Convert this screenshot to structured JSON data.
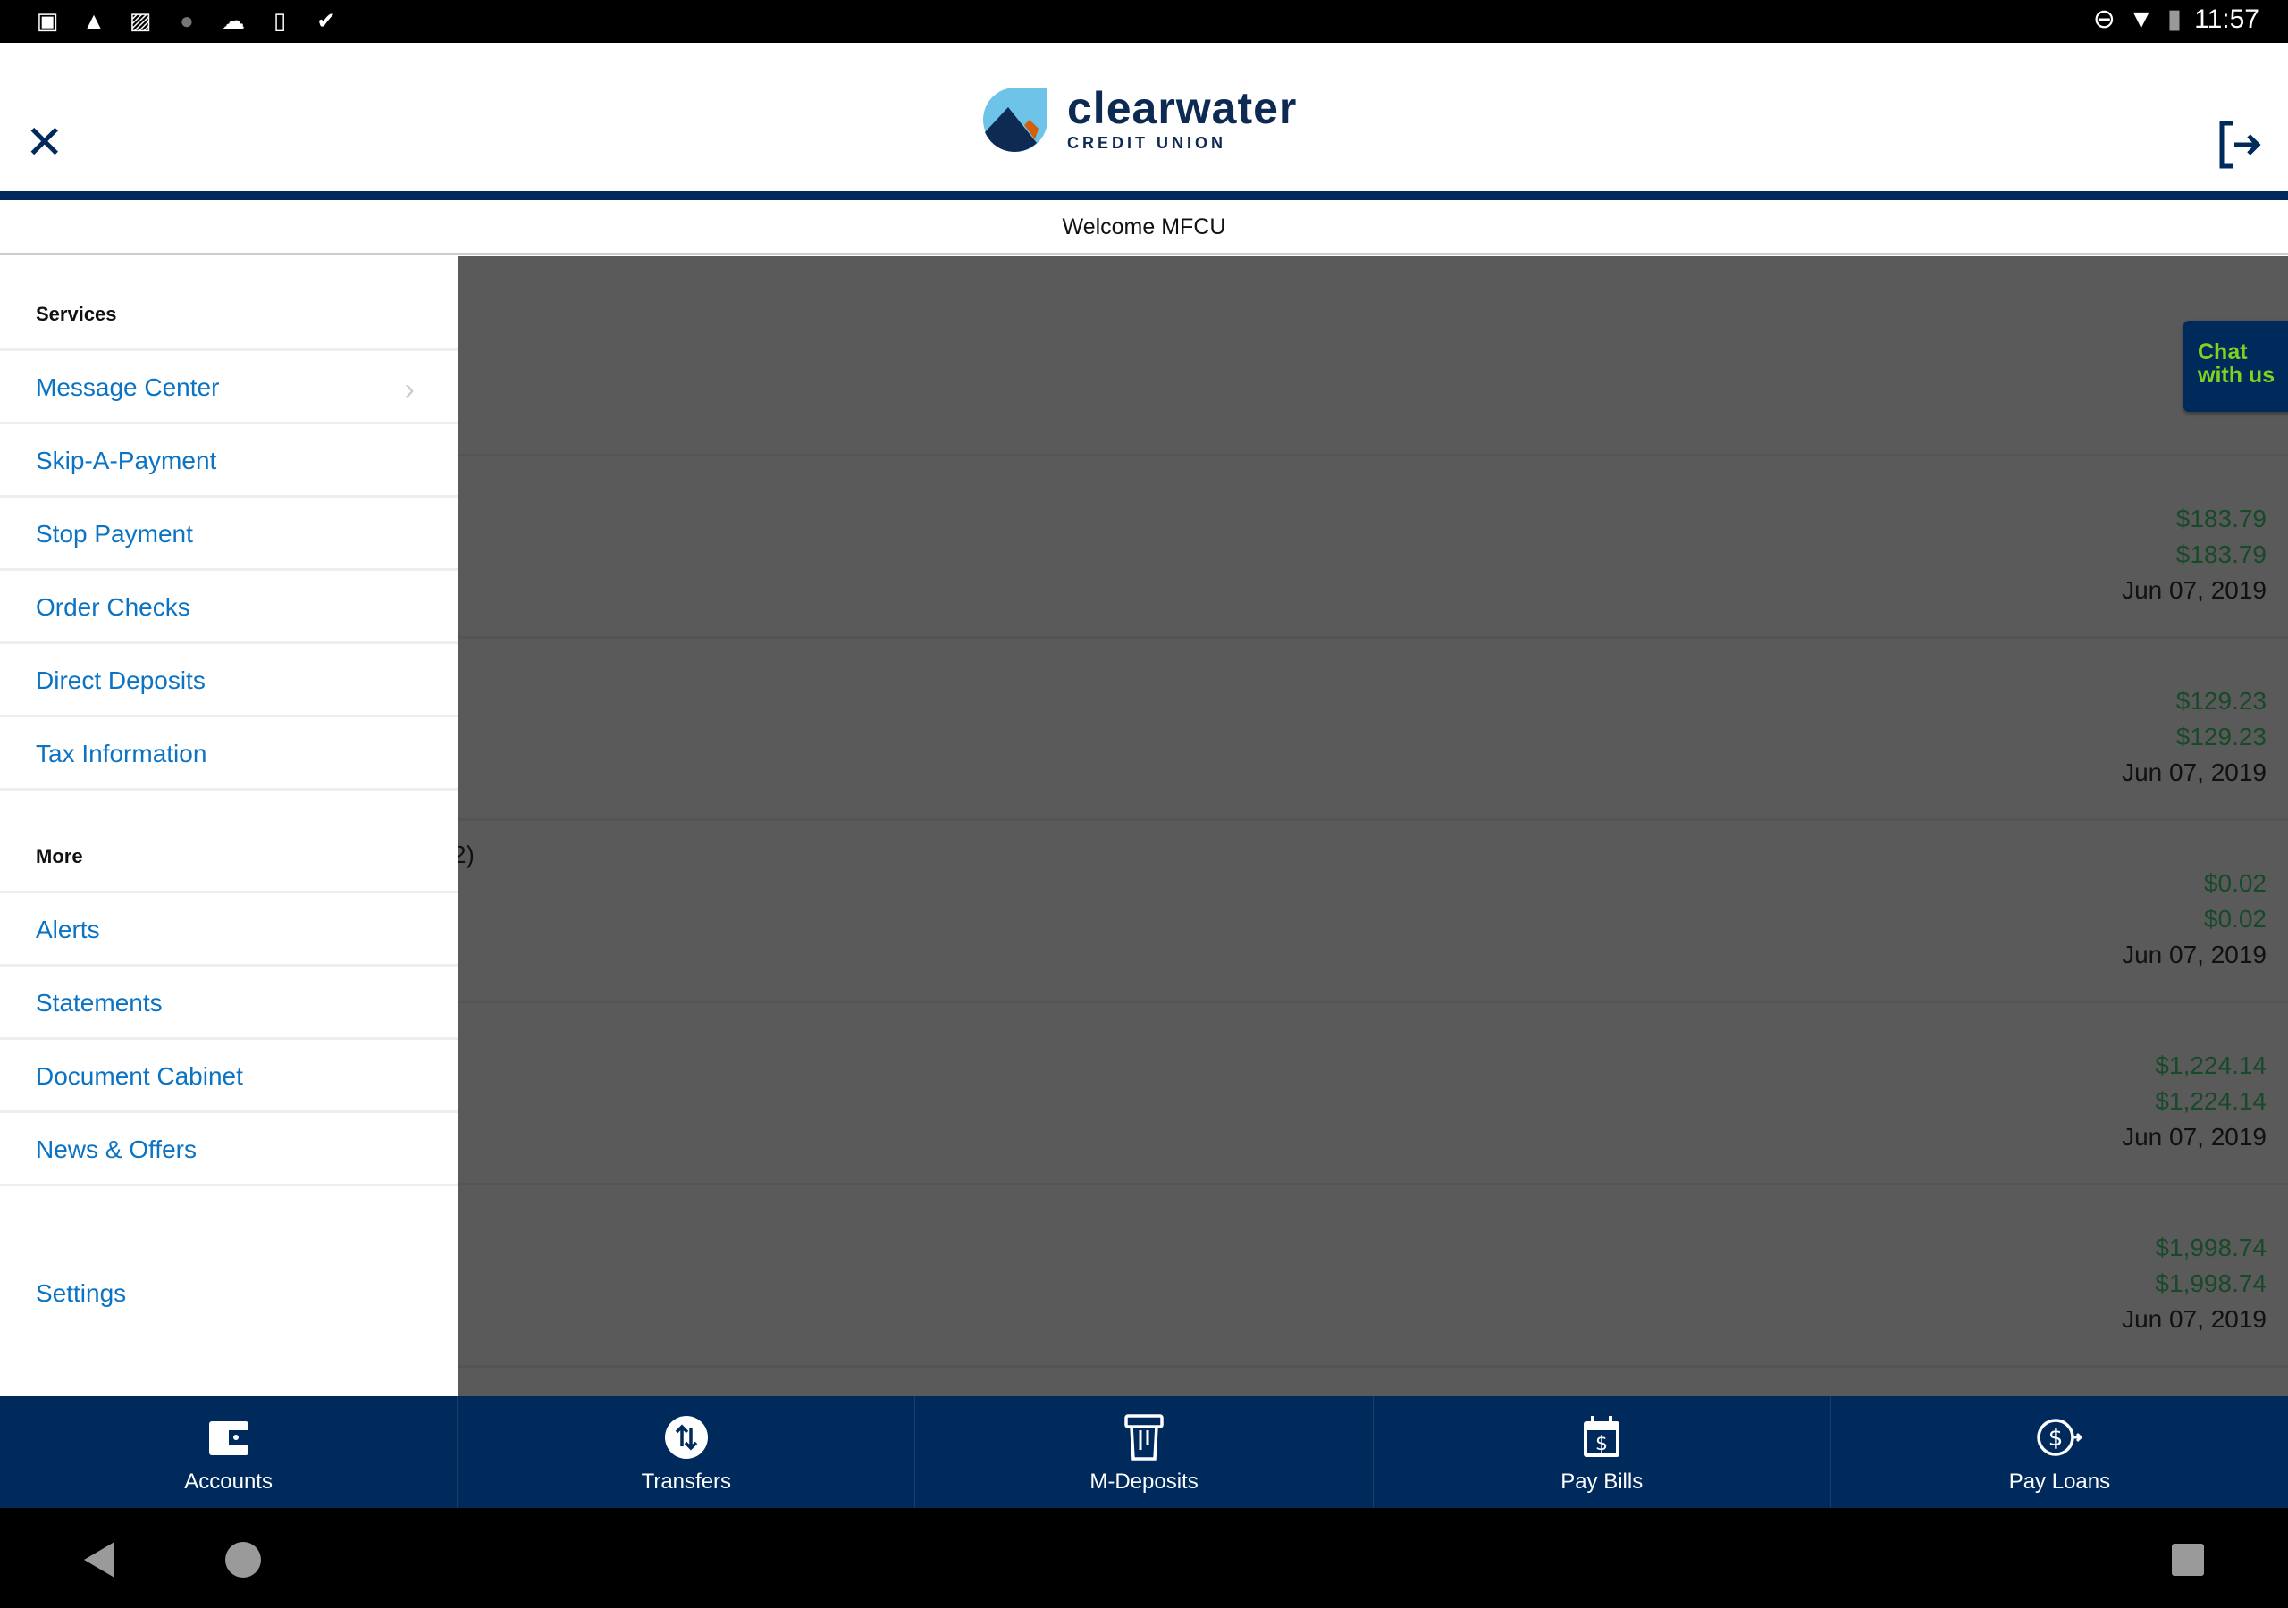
{
  "status_bar": {
    "time": "11:57",
    "left_icons": [
      "file-manager-icon",
      "warning-icon",
      "image-icon",
      "sync-icon",
      "cloud-icon",
      "phone-alert-icon",
      "check-icon"
    ],
    "right_icons": [
      "do-not-disturb-icon",
      "wifi-icon",
      "battery-charging-icon"
    ]
  },
  "header": {
    "logo_name": "clearwater",
    "logo_sub": "CREDIT UNION",
    "welcome": "Welcome MFCU"
  },
  "drawer": {
    "services_title": "Services",
    "services": [
      {
        "label": "Message Center"
      },
      {
        "label": "Skip-A-Payment"
      },
      {
        "label": "Stop Payment"
      },
      {
        "label": "Order Checks"
      },
      {
        "label": "Direct Deposits"
      },
      {
        "label": "Tax Information"
      }
    ],
    "more_title": "More",
    "more": [
      {
        "label": "Alerts"
      },
      {
        "label": "Statements"
      },
      {
        "label": "Document Cabinet"
      },
      {
        "label": "News & Offers"
      }
    ],
    "settings": "Settings"
  },
  "content": {
    "chat_line1": "Chat",
    "chat_line2": "with us",
    "partial_text": "2)",
    "accounts": [
      {
        "available": "$183.79",
        "current": "$183.79",
        "date": "Jun 07, 2019"
      },
      {
        "available": "$129.23",
        "current": "$129.23",
        "date": "Jun 07, 2019"
      },
      {
        "available": "$0.02",
        "current": "$0.02",
        "date": "Jun 07, 2019"
      },
      {
        "available": "$1,224.14",
        "current": "$1,224.14",
        "date": "Jun 07, 2019"
      },
      {
        "available": "$1,998.74",
        "current": "$1,998.74",
        "date": "Jun 07, 2019"
      }
    ]
  },
  "bottom_nav": [
    {
      "label": "Accounts"
    },
    {
      "label": "Transfers"
    },
    {
      "label": "M-Deposits"
    },
    {
      "label": "Pay Bills"
    },
    {
      "label": "Pay Loans"
    }
  ],
  "colors": {
    "brand_navy": "#002a5c",
    "link_blue": "#0a73c4",
    "chat_green": "#7ed321",
    "amount_green": "#184a2a",
    "logo_sky": "#6ec3e8",
    "logo_orange": "#d45f0a"
  }
}
